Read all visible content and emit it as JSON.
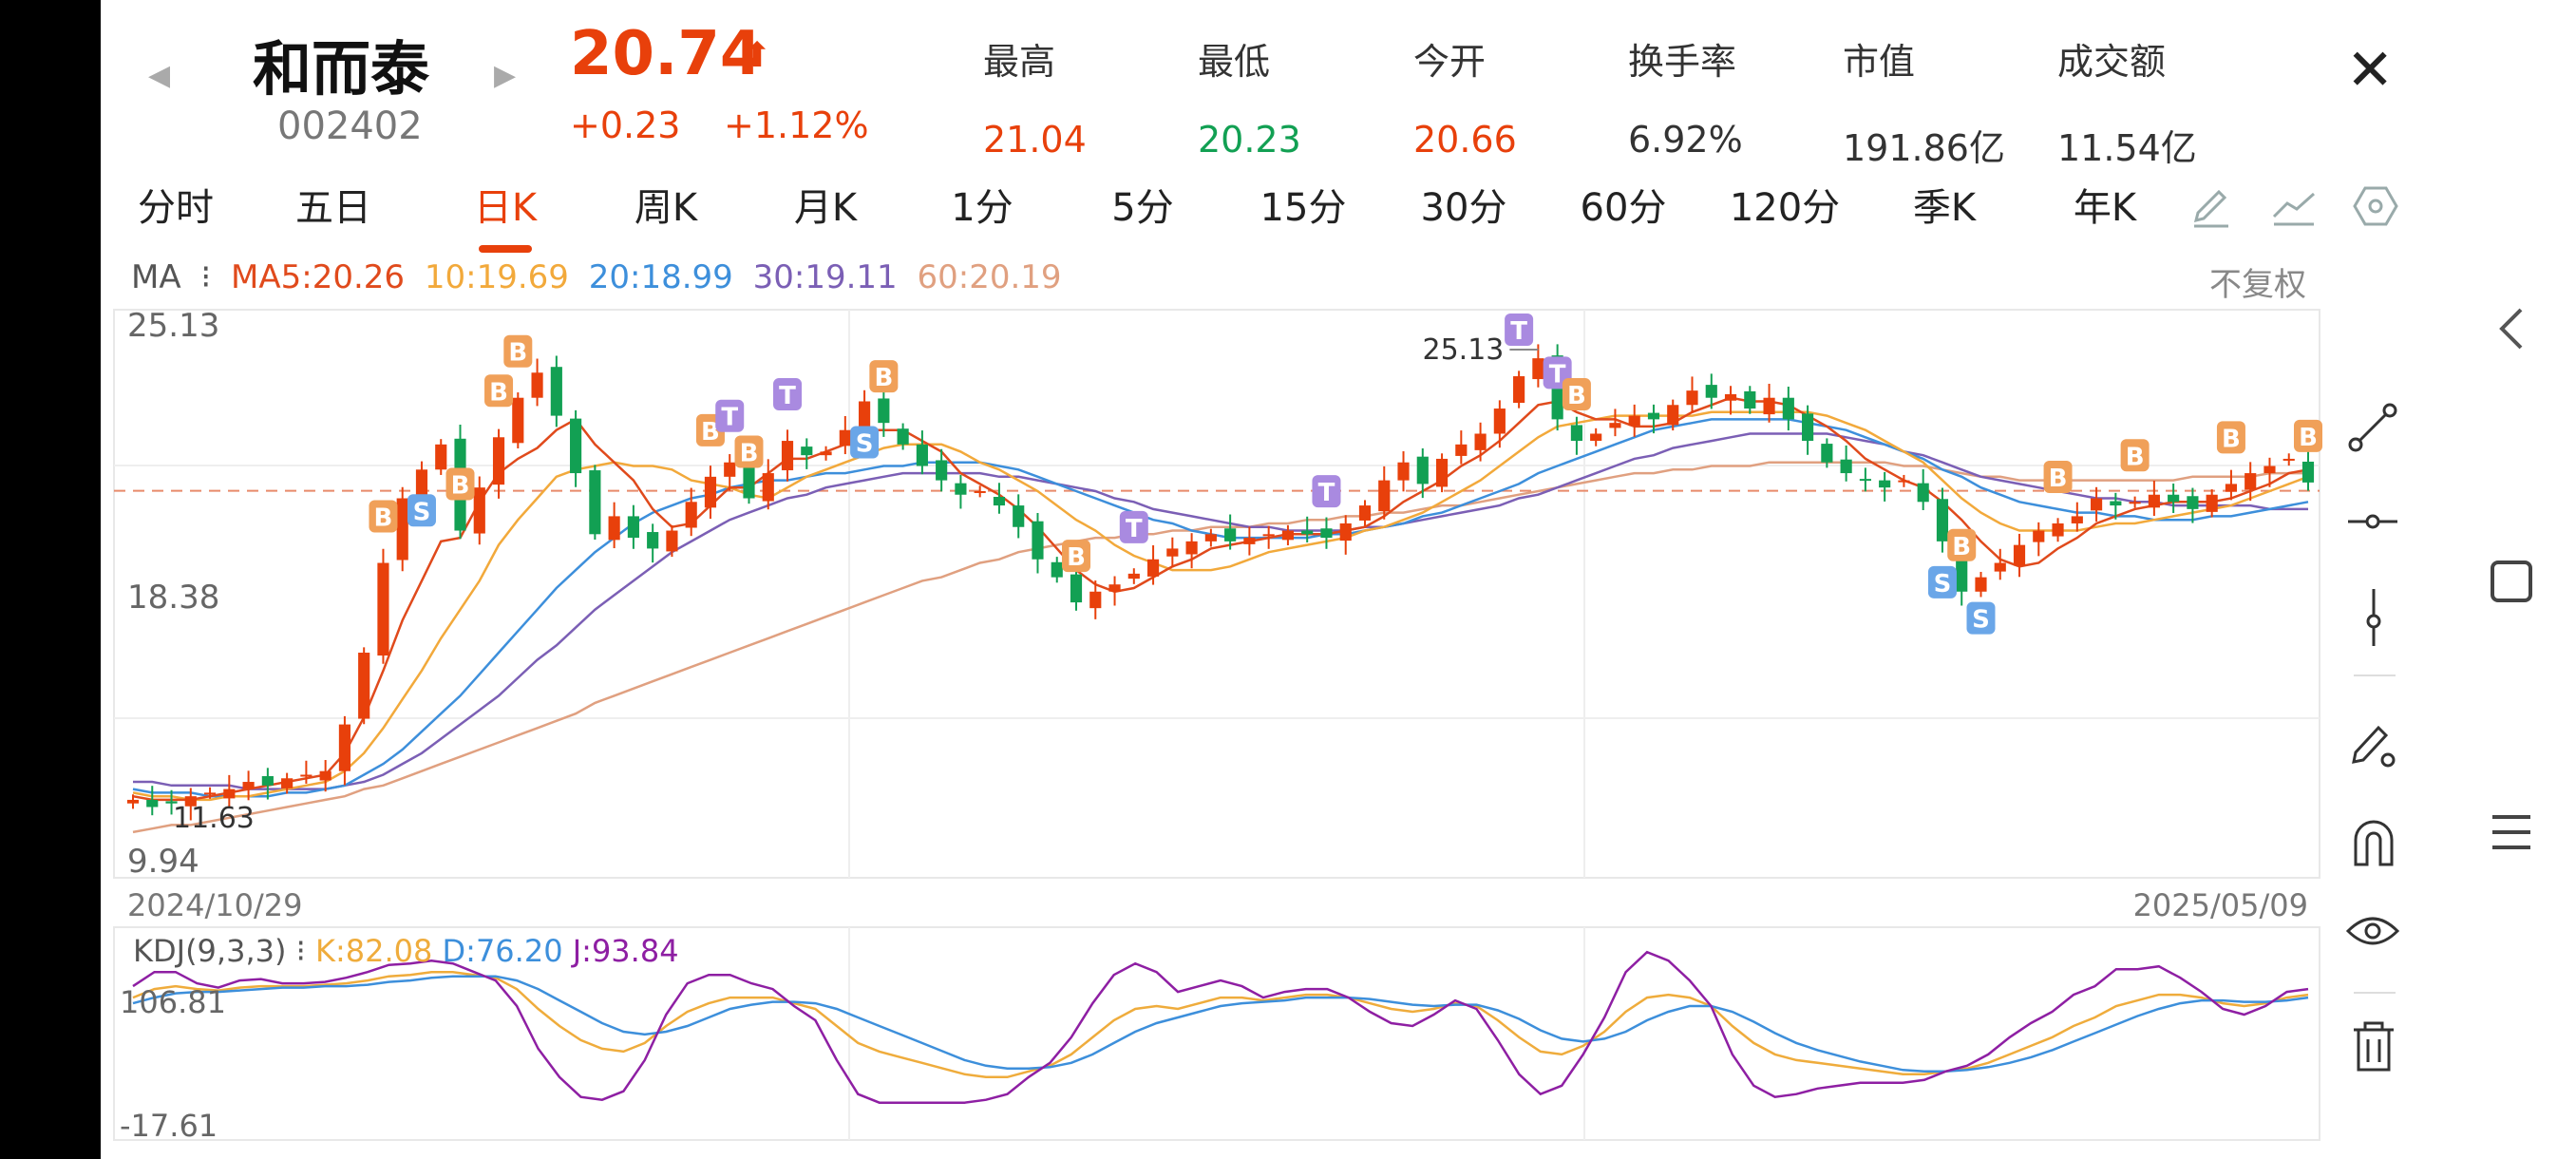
{
  "stock": {
    "name": "和而泰",
    "code": "002402",
    "price": "20.74",
    "change": "+0.23",
    "change_pct": "+1.12%"
  },
  "stats": [
    {
      "label": "最高",
      "value": "21.04",
      "color": "#e8400b"
    },
    {
      "label": "最低",
      "value": "20.23",
      "color": "#12a053"
    },
    {
      "label": "今开",
      "value": "20.66",
      "color": "#e8400b"
    },
    {
      "label": "换手率",
      "value": "6.92%",
      "color": "#333333"
    },
    {
      "label": "市值",
      "value": "191.86亿",
      "color": "#333333"
    },
    {
      "label": "成交额",
      "value": "11.54亿",
      "color": "#333333"
    }
  ],
  "tabs": [
    "分时",
    "五日",
    "日K",
    "周K",
    "月K",
    "1分",
    "5分",
    "15分",
    "30分",
    "60分",
    "120分",
    "季K",
    "年K"
  ],
  "active_tab": "日K",
  "toolbar_icons": [
    "pencil-icon",
    "trend-line-icon",
    "settings-hexagon-icon"
  ],
  "side_tools": [
    "chevron-left-icon",
    "line-segment-icon",
    "horizontal-line-icon",
    "vertical-line-icon",
    "pen-icon",
    "magnet-icon",
    "eye-icon",
    "trash-icon"
  ],
  "system_nav": [
    "square-icon",
    "menu-icon"
  ],
  "ma": {
    "prefix": "MA",
    "ma5": "MA5:20.26",
    "ma10": "10:19.69",
    "ma20": "20:18.99",
    "ma30": "30:19.11",
    "ma60": "60:20.19",
    "fuquan": "不复权"
  },
  "kdj": {
    "label": "KDJ(9,3,3)",
    "k": "K:82.08",
    "d": "D:76.20",
    "j": "J:93.84"
  },
  "colors": {
    "up": "#e8400b",
    "down": "#12a053",
    "ma5": "#e04a1c",
    "ma10": "#f2a93b",
    "ma20": "#3d8fdb",
    "ma30": "#7b5fb5",
    "ma60": "#e0a080",
    "kdj_k": "#efac3c",
    "kdj_d": "#3d8fdb",
    "kdj_j": "#8e1fa3"
  },
  "chart_data": [
    {
      "type": "candlestick",
      "y_ticks": [
        "25.13",
        "18.38",
        "9.94"
      ],
      "ylim": [
        9.94,
        25.13
      ],
      "date_start": "2024/10/29",
      "date_end": "2025/05/09",
      "high_annotation": "25.13",
      "low_annotation": "11.63",
      "reference_price": 20.51,
      "closes": [
        11.9,
        11.7,
        11.8,
        12.0,
        12.1,
        12.2,
        12.4,
        12.3,
        12.5,
        12.6,
        12.7,
        14.0,
        16.0,
        18.5,
        20.3,
        21.1,
        21.8,
        19.4,
        20.6,
        22.0,
        23.1,
        23.8,
        22.6,
        21.0,
        19.3,
        19.8,
        19.2,
        18.9,
        19.4,
        20.2,
        20.9,
        21.3,
        20.3,
        21.0,
        21.9,
        21.5,
        21.6,
        22.2,
        23.0,
        22.4,
        21.8,
        21.2,
        20.8,
        20.4,
        20.5,
        20.1,
        19.5,
        18.6,
        18.1,
        17.4,
        17.7,
        17.9,
        18.2,
        18.6,
        18.9,
        19.1,
        19.3,
        19.1,
        19.2,
        19.3,
        19.4,
        19.3,
        19.2,
        19.6,
        20.1,
        20.8,
        21.3,
        20.7,
        21.4,
        21.8,
        22.1,
        22.8,
        23.7,
        24.2,
        22.5,
        21.9,
        22.1,
        22.4,
        22.6,
        22.5,
        22.9,
        23.3,
        23.1,
        23.2,
        22.8,
        23.1,
        22.5,
        21.9,
        21.3,
        21.0,
        20.8,
        20.6,
        20.8,
        20.2,
        19.1,
        17.7,
        18.1,
        18.5,
        19.0,
        19.4,
        19.6,
        19.8,
        20.3,
        20.1,
        20.2,
        20.4,
        20.2,
        20.0,
        20.4,
        20.7,
        21.0,
        21.2,
        21.4,
        20.74
      ],
      "ma5": [
        12.0,
        11.9,
        11.9,
        11.9,
        12.0,
        12.1,
        12.2,
        12.3,
        12.4,
        12.5,
        12.6,
        13.2,
        14.2,
        15.5,
        16.9,
        18.0,
        19.1,
        19.2,
        20.2,
        21.0,
        21.4,
        21.7,
        22.2,
        22.5,
        21.8,
        21.3,
        20.8,
        20.0,
        19.5,
        19.6,
        20.1,
        20.6,
        20.6,
        21.0,
        21.4,
        21.4,
        21.6,
        21.8,
        22.2,
        22.2,
        22.2,
        21.9,
        21.6,
        21.0,
        20.7,
        20.4,
        20.0,
        19.5,
        18.9,
        18.3,
        17.9,
        17.7,
        17.8,
        18.1,
        18.4,
        18.6,
        18.9,
        19.0,
        19.1,
        19.2,
        19.3,
        19.3,
        19.3,
        19.4,
        19.5,
        19.8,
        20.2,
        20.5,
        20.8,
        21.2,
        21.5,
        21.9,
        22.4,
        22.9,
        23.0,
        22.7,
        22.5,
        22.5,
        22.3,
        22.3,
        22.4,
        22.7,
        22.9,
        23.1,
        23.0,
        23.0,
        22.9,
        22.6,
        22.3,
        21.9,
        21.4,
        21.1,
        20.8,
        20.6,
        20.2,
        19.7,
        19.1,
        18.6,
        18.4,
        18.5,
        18.9,
        19.2,
        19.6,
        19.8,
        20.0,
        20.1,
        20.2,
        20.2,
        20.2,
        20.3,
        20.5,
        20.7,
        21.0,
        21.1
      ],
      "ma10": [
        12.1,
        12.0,
        12.0,
        11.9,
        11.9,
        12.0,
        12.0,
        12.1,
        12.2,
        12.3,
        12.4,
        12.7,
        13.2,
        13.9,
        14.7,
        15.5,
        16.4,
        17.2,
        18.0,
        19.0,
        19.7,
        20.3,
        20.9,
        21.1,
        21.2,
        21.3,
        21.2,
        21.2,
        21.1,
        20.8,
        20.7,
        20.6,
        20.4,
        20.3,
        20.6,
        20.9,
        21.1,
        21.3,
        21.5,
        21.7,
        21.8,
        21.8,
        21.8,
        21.6,
        21.3,
        21.1,
        20.8,
        20.5,
        20.1,
        19.7,
        19.4,
        19.0,
        18.7,
        18.5,
        18.3,
        18.3,
        18.3,
        18.4,
        18.6,
        18.8,
        18.9,
        19.0,
        19.1,
        19.2,
        19.4,
        19.5,
        19.7,
        19.9,
        20.2,
        20.5,
        20.8,
        21.2,
        21.6,
        22.0,
        22.3,
        22.4,
        22.5,
        22.6,
        22.6,
        22.6,
        22.6,
        22.6,
        22.7,
        22.7,
        22.7,
        22.7,
        22.7,
        22.7,
        22.6,
        22.4,
        22.2,
        21.9,
        21.6,
        21.3,
        20.8,
        20.3,
        19.9,
        19.6,
        19.4,
        19.4,
        19.4,
        19.4,
        19.5,
        19.6,
        19.6,
        19.7,
        19.8,
        19.9,
        20.0,
        20.1,
        20.3,
        20.5,
        20.7,
        20.9
      ],
      "ma20": [
        12.2,
        12.1,
        12.1,
        12.1,
        12.0,
        12.0,
        12.0,
        12.0,
        12.1,
        12.1,
        12.2,
        12.3,
        12.6,
        12.9,
        13.3,
        13.8,
        14.3,
        14.8,
        15.4,
        16.0,
        16.6,
        17.2,
        17.8,
        18.3,
        18.8,
        19.2,
        19.6,
        19.9,
        20.1,
        20.3,
        20.4,
        20.6,
        20.7,
        20.8,
        20.8,
        20.9,
        21.0,
        21.0,
        21.1,
        21.2,
        21.2,
        21.3,
        21.3,
        21.3,
        21.3,
        21.2,
        21.1,
        20.9,
        20.7,
        20.5,
        20.3,
        20.1,
        19.9,
        19.7,
        19.6,
        19.4,
        19.3,
        19.2,
        19.2,
        19.2,
        19.2,
        19.2,
        19.3,
        19.3,
        19.4,
        19.5,
        19.6,
        19.8,
        19.9,
        20.1,
        20.3,
        20.5,
        20.7,
        21.0,
        21.2,
        21.4,
        21.6,
        21.8,
        22.0,
        22.2,
        22.3,
        22.4,
        22.5,
        22.5,
        22.5,
        22.5,
        22.5,
        22.4,
        22.3,
        22.2,
        22.0,
        21.8,
        21.6,
        21.4,
        21.1,
        20.9,
        20.6,
        20.4,
        20.2,
        20.1,
        20.0,
        19.9,
        19.9,
        19.8,
        19.8,
        19.7,
        19.7,
        19.7,
        19.8,
        19.8,
        19.9,
        20.0,
        20.1,
        20.2
      ],
      "ma30": [
        12.4,
        12.4,
        12.3,
        12.3,
        12.3,
        12.3,
        12.2,
        12.2,
        12.2,
        12.2,
        12.2,
        12.3,
        12.4,
        12.6,
        12.9,
        13.2,
        13.6,
        14.0,
        14.4,
        14.8,
        15.3,
        15.8,
        16.2,
        16.7,
        17.2,
        17.6,
        18.0,
        18.4,
        18.8,
        19.1,
        19.4,
        19.7,
        19.9,
        20.1,
        20.3,
        20.4,
        20.6,
        20.7,
        20.8,
        20.9,
        21.0,
        21.0,
        21.0,
        21.0,
        21.0,
        20.9,
        20.9,
        20.8,
        20.7,
        20.6,
        20.5,
        20.3,
        20.2,
        20.0,
        19.9,
        19.8,
        19.7,
        19.6,
        19.5,
        19.5,
        19.4,
        19.4,
        19.4,
        19.4,
        19.5,
        19.5,
        19.6,
        19.7,
        19.8,
        19.9,
        20.0,
        20.1,
        20.3,
        20.4,
        20.6,
        20.8,
        21.0,
        21.2,
        21.4,
        21.5,
        21.7,
        21.8,
        21.9,
        22.0,
        22.1,
        22.1,
        22.1,
        22.1,
        22.1,
        22.0,
        21.9,
        21.8,
        21.6,
        21.5,
        21.3,
        21.1,
        20.9,
        20.8,
        20.7,
        20.6,
        20.5,
        20.4,
        20.3,
        20.3,
        20.2,
        20.2,
        20.1,
        20.1,
        20.1,
        20.1,
        20.1,
        20.0,
        20.0,
        20.0
      ],
      "ma60": [
        11.0,
        11.1,
        11.2,
        11.2,
        11.3,
        11.4,
        11.5,
        11.6,
        11.7,
        11.8,
        11.9,
        12.0,
        12.2,
        12.3,
        12.5,
        12.7,
        12.9,
        13.1,
        13.3,
        13.5,
        13.7,
        13.9,
        14.1,
        14.3,
        14.6,
        14.8,
        15.0,
        15.2,
        15.4,
        15.6,
        15.8,
        16.0,
        16.2,
        16.4,
        16.6,
        16.8,
        17.0,
        17.2,
        17.4,
        17.6,
        17.8,
        18.0,
        18.1,
        18.3,
        18.5,
        18.6,
        18.8,
        18.9,
        19.0,
        19.1,
        19.2,
        19.2,
        19.3,
        19.3,
        19.4,
        19.4,
        19.5,
        19.5,
        19.5,
        19.6,
        19.6,
        19.7,
        19.7,
        19.8,
        19.8,
        19.9,
        19.9,
        20.0,
        20.1,
        20.1,
        20.2,
        20.3,
        20.4,
        20.5,
        20.6,
        20.7,
        20.8,
        20.9,
        21.0,
        21.0,
        21.1,
        21.1,
        21.2,
        21.2,
        21.2,
        21.3,
        21.3,
        21.3,
        21.3,
        21.3,
        21.3,
        21.3,
        21.2,
        21.2,
        21.1,
        21.0,
        20.9,
        20.9,
        20.8,
        20.8,
        20.8,
        20.8,
        20.8,
        20.8,
        20.8,
        20.8,
        20.8,
        20.9,
        20.9,
        20.9,
        20.9,
        21.0,
        21.0,
        21.0
      ],
      "markers": [
        {
          "i": 13,
          "label": "B",
          "kind": "B"
        },
        {
          "i": 15,
          "label": "S",
          "kind": "S"
        },
        {
          "i": 17,
          "label": "B",
          "kind": "B"
        },
        {
          "i": 19,
          "label": "B",
          "kind": "B"
        },
        {
          "i": 20,
          "label": "B",
          "kind": "B"
        },
        {
          "i": 30,
          "label": "B",
          "kind": "B"
        },
        {
          "i": 31,
          "label": "T",
          "kind": "T"
        },
        {
          "i": 32,
          "label": "B",
          "kind": "B"
        },
        {
          "i": 34,
          "label": "T",
          "kind": "T"
        },
        {
          "i": 38,
          "label": "S",
          "kind": "S"
        },
        {
          "i": 39,
          "label": "B",
          "kind": "B"
        },
        {
          "i": 49,
          "label": "B",
          "kind": "B"
        },
        {
          "i": 52,
          "label": "T",
          "kind": "T"
        },
        {
          "i": 62,
          "label": "T",
          "kind": "T"
        },
        {
          "i": 72,
          "label": "T",
          "kind": "T"
        },
        {
          "i": 74,
          "label": "T",
          "kind": "T"
        },
        {
          "i": 75,
          "label": "B",
          "kind": "B"
        },
        {
          "i": 94,
          "label": "S",
          "kind": "S"
        },
        {
          "i": 95,
          "label": "B",
          "kind": "B"
        },
        {
          "i": 96,
          "label": "S",
          "kind": "S"
        },
        {
          "i": 100,
          "label": "B",
          "kind": "B"
        },
        {
          "i": 104,
          "label": "B",
          "kind": "B"
        },
        {
          "i": 109,
          "label": "B",
          "kind": "B"
        },
        {
          "i": 113,
          "label": "B",
          "kind": "B"
        }
      ]
    },
    {
      "type": "line",
      "name": "KDJ",
      "y_ticks": [
        "106.81",
        "-17.61"
      ],
      "ylim": [
        -17.61,
        106.81
      ],
      "series": [
        {
          "name": "K",
          "values": [
            80,
            86,
            88,
            86,
            85,
            87,
            88,
            88,
            88,
            89,
            90,
            92,
            95,
            96,
            98,
            98,
            96,
            94,
            86,
            72,
            60,
            50,
            44,
            42,
            48,
            60,
            70,
            76,
            80,
            80,
            80,
            76,
            72,
            60,
            48,
            42,
            38,
            34,
            30,
            26,
            24,
            24,
            28,
            32,
            40,
            52,
            64,
            72,
            74,
            72,
            76,
            80,
            80,
            78,
            80,
            82,
            82,
            80,
            76,
            72,
            70,
            72,
            76,
            74,
            64,
            52,
            42,
            40,
            46,
            56,
            70,
            80,
            82,
            80,
            74,
            60,
            48,
            40,
            36,
            34,
            32,
            30,
            28,
            26,
            26,
            28,
            30,
            34,
            40,
            46,
            52,
            60,
            66,
            74,
            78,
            82,
            82,
            80,
            76,
            74,
            76,
            80,
            82
          ]
        },
        {
          "name": "D",
          "values": [
            76,
            80,
            83,
            84,
            84,
            85,
            86,
            87,
            87,
            88,
            88,
            89,
            91,
            92,
            94,
            95,
            95,
            95,
            92,
            86,
            78,
            70,
            62,
            56,
            54,
            56,
            60,
            66,
            72,
            75,
            77,
            77,
            76,
            72,
            66,
            60,
            54,
            48,
            42,
            36,
            32,
            30,
            30,
            31,
            34,
            40,
            48,
            56,
            62,
            66,
            70,
            74,
            76,
            77,
            78,
            80,
            80,
            80,
            79,
            77,
            75,
            74,
            75,
            75,
            71,
            65,
            57,
            51,
            49,
            51,
            56,
            64,
            70,
            74,
            74,
            70,
            63,
            55,
            48,
            43,
            39,
            35,
            32,
            29,
            28,
            28,
            29,
            31,
            34,
            38,
            43,
            49,
            55,
            61,
            67,
            72,
            76,
            78,
            78,
            77,
            77,
            78,
            80
          ]
        },
        {
          "name": "J",
          "values": [
            88,
            98,
            98,
            90,
            87,
            92,
            93,
            90,
            90,
            91,
            94,
            98,
            103,
            104,
            106,
            104,
            98,
            92,
            74,
            44,
            24,
            10,
            8,
            14,
            36,
            68,
            90,
            96,
            96,
            90,
            86,
            74,
            64,
            36,
            12,
            6,
            6,
            6,
            6,
            6,
            8,
            12,
            24,
            34,
            52,
            76,
            96,
            104,
            98,
            84,
            88,
            92,
            88,
            80,
            84,
            86,
            86,
            80,
            70,
            62,
            60,
            68,
            78,
            72,
            50,
            26,
            12,
            18,
            40,
            66,
            98,
            112,
            106,
            92,
            74,
            40,
            18,
            10,
            12,
            16,
            18,
            20,
            20,
            20,
            22,
            28,
            32,
            40,
            52,
            62,
            70,
            82,
            88,
            100,
            100,
            102,
            94,
            84,
            72,
            68,
            74,
            84,
            86
          ]
        }
      ]
    }
  ]
}
